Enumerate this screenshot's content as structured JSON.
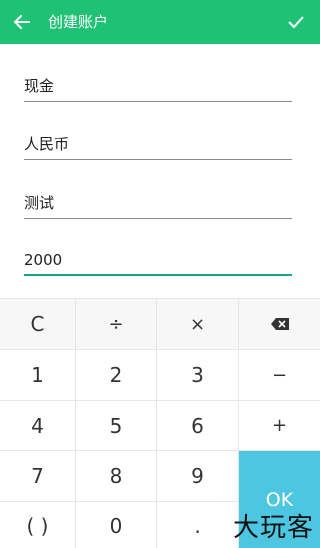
{
  "appbar": {
    "title": "创建账户",
    "back_icon": "arrow-left-icon",
    "confirm_icon": "checkmark-icon",
    "color": "#1fc274"
  },
  "form": {
    "account_type": "现金",
    "currency": "人民币",
    "name": "测试",
    "balance": "2000"
  },
  "keypad": {
    "clear": "C",
    "divide": "÷",
    "multiply": "×",
    "backspace_icon": "backspace-icon",
    "k1": "1",
    "k2": "2",
    "k3": "3",
    "minus": "−",
    "k4": "4",
    "k5": "5",
    "k6": "6",
    "plus": "+",
    "k7": "7",
    "k8": "8",
    "k9": "9",
    "parens": "( )",
    "k0": "0",
    "dot": ".",
    "ok": "OK",
    "ok_color": "#4dc6e2"
  },
  "watermark": "大玩客"
}
